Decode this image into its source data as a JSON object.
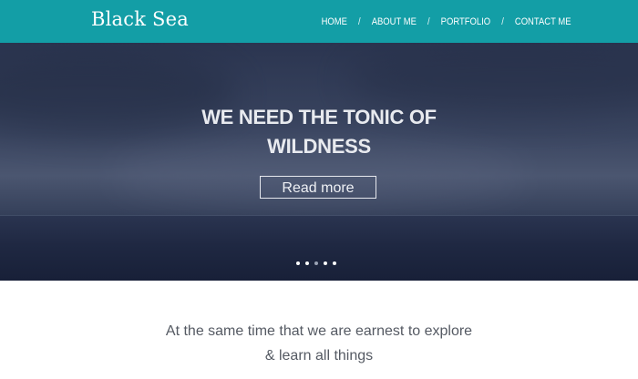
{
  "header": {
    "brand": "Black Sea",
    "background_color": "#139ea6",
    "nav": [
      {
        "label": "HOME"
      },
      {
        "label": "ABOUT ME"
      },
      {
        "label": "PORTFOLIO"
      },
      {
        "label": "CONTACT ME"
      }
    ],
    "separator": "/"
  },
  "hero": {
    "title_line1": "WE NEED THE TONIC OF",
    "title_line2": "WILDNESS",
    "button_label": "Read more",
    "slides": 5,
    "active_slide": 3
  },
  "content": {
    "tagline_line1": "At the same time that we are earnest to explore",
    "tagline_line2": "& learn all things"
  }
}
